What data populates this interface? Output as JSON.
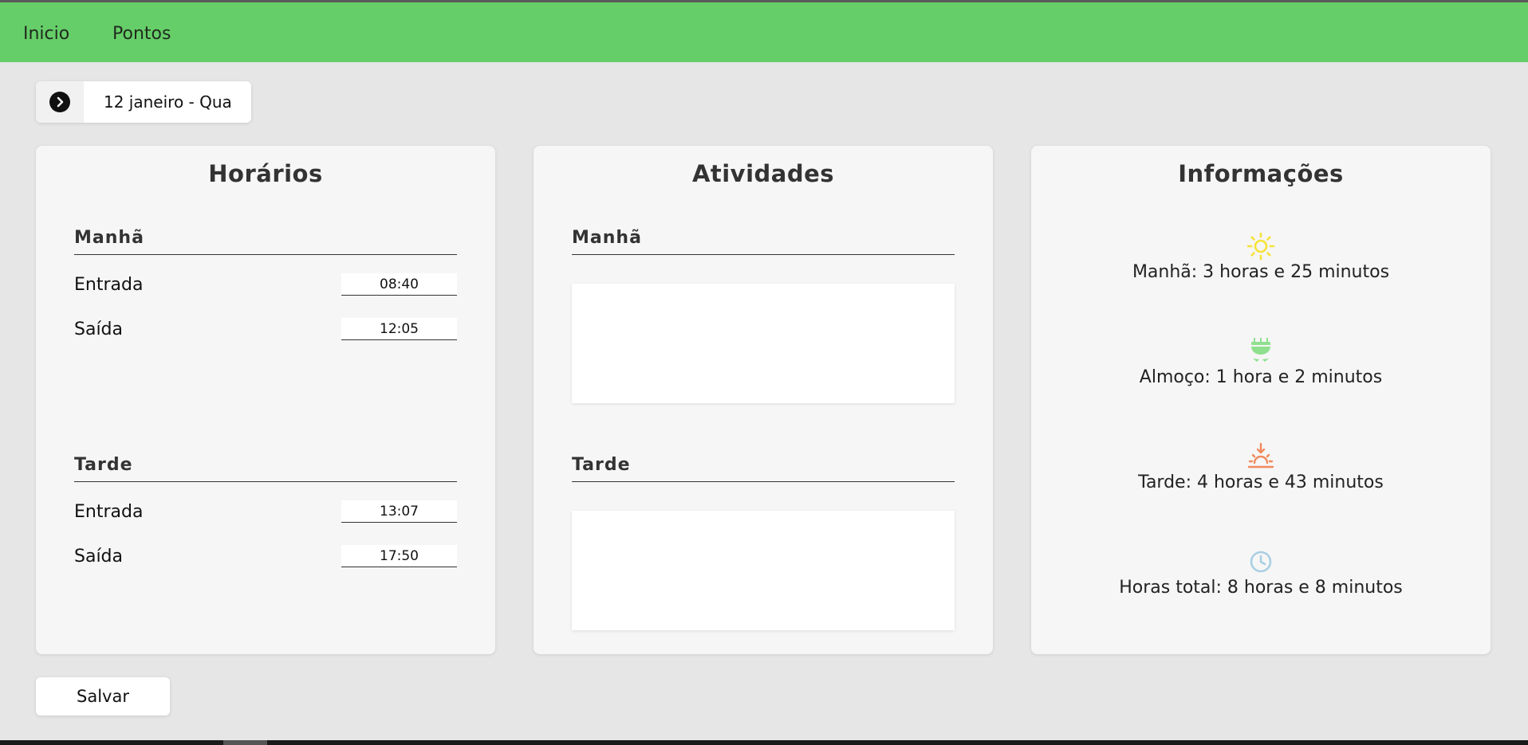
{
  "nav": {
    "items": [
      {
        "label": "Inicio"
      },
      {
        "label": "Pontos"
      }
    ]
  },
  "date_selector": {
    "label": "12 janeiro - Qua",
    "icon": "chevron-right-icon"
  },
  "horarios": {
    "title": "Horários",
    "manha": {
      "title": "Manhã",
      "entrada_label": "Entrada",
      "entrada_value": "08:40",
      "saida_label": "Saída",
      "saida_value": "12:05"
    },
    "tarde": {
      "title": "Tarde",
      "entrada_label": "Entrada",
      "entrada_value": "13:07",
      "saida_label": "Saída",
      "saida_value": "17:50"
    }
  },
  "atividades": {
    "title": "Atividades",
    "manha_title": "Manhã",
    "manha_value": "",
    "tarde_title": "Tarde",
    "tarde_value": ""
  },
  "informacoes": {
    "title": "Informações",
    "items": [
      {
        "icon": "sun-icon",
        "color": "#f7e23a",
        "text": "Manhã: 3 horas e 25 minutos"
      },
      {
        "icon": "lunch-icon",
        "color": "#8ee08e",
        "text": "Almoço: 1 hora e 2 minutos"
      },
      {
        "icon": "sunset-icon",
        "color": "#f08a5d",
        "text": "Tarde: 4 horas e 43 minutos"
      },
      {
        "icon": "clock-icon",
        "color": "#a9cfe3",
        "text": "Horas total: 8 horas e 8 minutos"
      }
    ]
  },
  "actions": {
    "save_label": "Salvar"
  },
  "colors": {
    "navbar": "#66ce68",
    "background": "#e6e6e6",
    "card": "#f6f6f6"
  }
}
